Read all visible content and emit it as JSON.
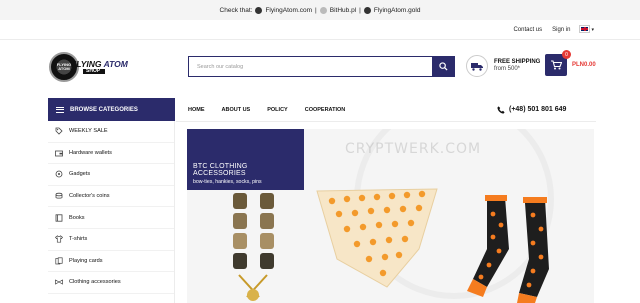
{
  "topbar": {
    "prefix": "Check that:",
    "link1": "FlyingAtom.com",
    "sep1": "|",
    "link2": "BitHub.pl",
    "sep2": "|",
    "link3": "FlyingAtom.gold"
  },
  "utilbar": {
    "contact": "Contact us",
    "signin": "Sign in"
  },
  "logo": {
    "circle_text": "FLYING ATOM",
    "word1": "FLYING",
    "word2": "ATOM",
    "shop": "SHOP"
  },
  "search": {
    "placeholder": "Search our catalog"
  },
  "shipping": {
    "title": "FREE SHIPPING",
    "subtitle": "from 500*"
  },
  "cart": {
    "count": "0",
    "total": "PLN0.00"
  },
  "nav": {
    "browse_label": "BROWSE CATEGORIES",
    "items": [
      "HOME",
      "ABOUT US",
      "POLICY",
      "COOPERATION"
    ],
    "phone": "(+48) 501 801 649"
  },
  "sidebar": {
    "items": [
      {
        "label": "WEEKLY SALE",
        "icon": "tag-icon"
      },
      {
        "label": "Hardware wallets",
        "icon": "wallet-icon"
      },
      {
        "label": "Gadgets",
        "icon": "gadget-icon"
      },
      {
        "label": "Collector's coins",
        "icon": "coins-icon"
      },
      {
        "label": "Books",
        "icon": "book-icon"
      },
      {
        "label": "T-shirts",
        "icon": "tshirt-icon"
      },
      {
        "label": "Playing cards",
        "icon": "cards-icon"
      },
      {
        "label": "Clothing accessories",
        "icon": "accessories-icon"
      }
    ]
  },
  "banner": {
    "title": "BTC CLOTHING ACCESSORIES",
    "subtitle": "bow-ties, hankies, socks, pins",
    "watermark": "CRYPTWERK.COM"
  },
  "colors": {
    "brand_navy": "#2b2b6b",
    "cart_red": "#e53935"
  }
}
